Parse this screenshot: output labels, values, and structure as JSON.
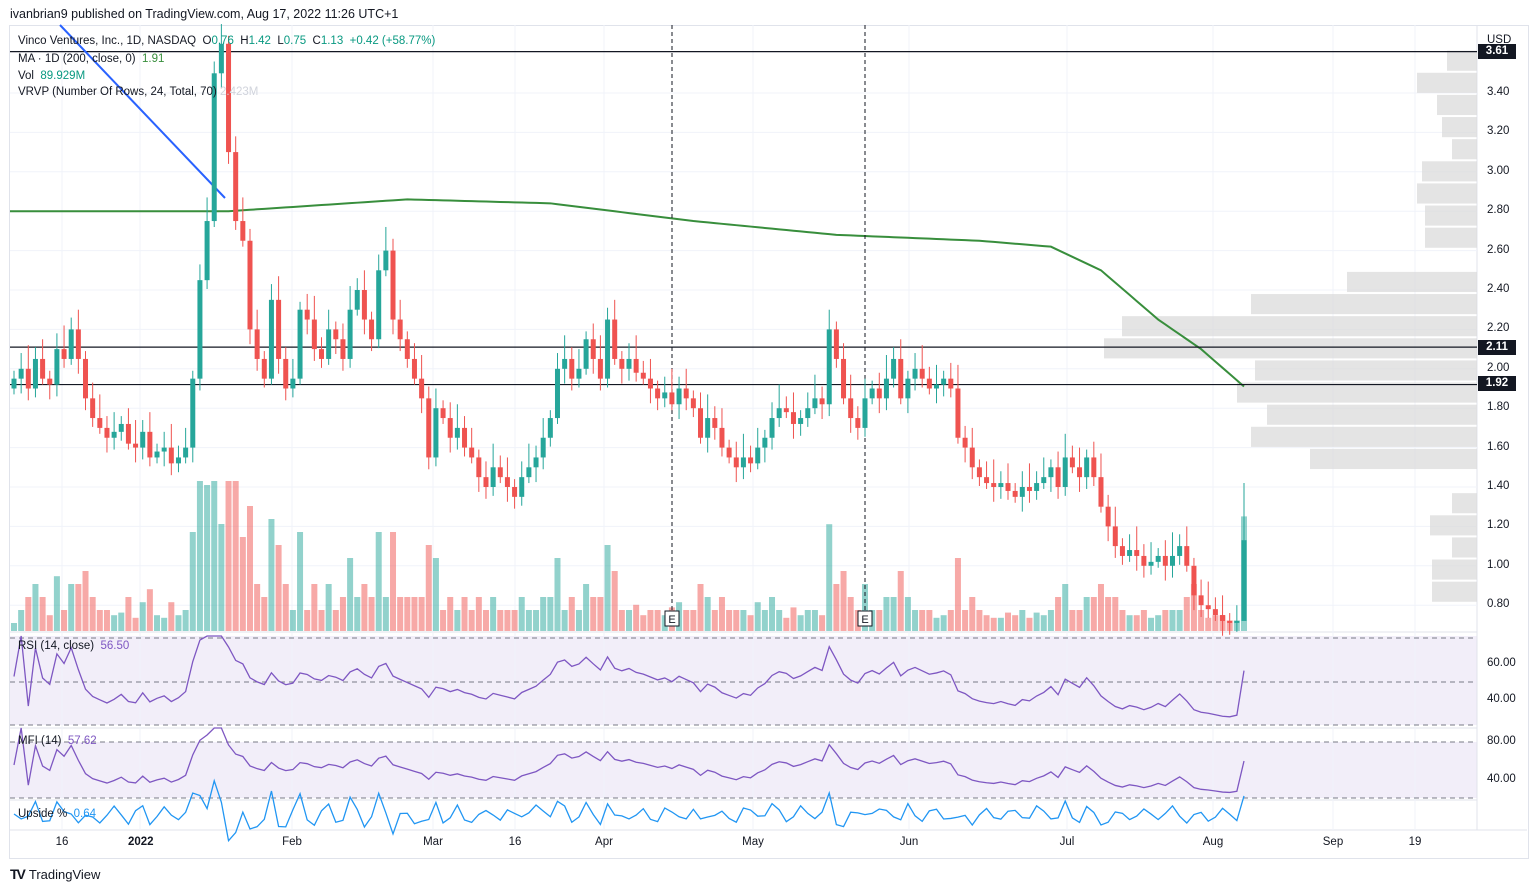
{
  "published": "ivanbrian9 published on TradingView.com, Aug 17, 2022 11:26 UTC+1",
  "legend": {
    "symbol": "Vinco Ventures, Inc., 1D, NASDAQ",
    "o_label": "O",
    "o": "0.76",
    "h_label": "H",
    "h": "1.42",
    "l_label": "L",
    "l": "0.75",
    "c_label": "C",
    "c": "1.13",
    "change": "+0.42 (+58.77%)",
    "ma": "MA · 1D (200, close, 0)",
    "ma_val": "1.91",
    "vol": "Vol",
    "vol_val": "89.929M",
    "vrvp": "VRVP (Number Of Rows, 24, Total, 70)",
    "vrvp_val": "2.423M",
    "rsi": "RSI (14, close)",
    "rsi_val": "56.50",
    "mfi": "MFI (14)",
    "mfi_val": "57.62",
    "upside": "Upside %",
    "upside_val": "0.64"
  },
  "currency": "USD",
  "price_ticks": [
    "3.40",
    "3.20",
    "3.00",
    "2.80",
    "2.60",
    "2.40",
    "2.20",
    "2.00",
    "1.80",
    "1.60",
    "1.40",
    "1.20",
    "1.00",
    "0.80"
  ],
  "price_tags": [
    "3.61",
    "2.11",
    "1.92"
  ],
  "rsi_ticks": [
    "60.00",
    "40.00"
  ],
  "mfi_ticks": [
    "80.00",
    "40.00"
  ],
  "time_ticks": [
    {
      "t": "16",
      "bold": false
    },
    {
      "t": "2022",
      "bold": true
    },
    {
      "t": "Feb",
      "bold": false
    },
    {
      "t": "Mar",
      "bold": false
    },
    {
      "t": "16",
      "bold": false
    },
    {
      "t": "Apr",
      "bold": false
    },
    {
      "t": "May",
      "bold": false
    },
    {
      "t": "Jun",
      "bold": false
    },
    {
      "t": "Jul",
      "bold": false
    },
    {
      "t": "Aug",
      "bold": false
    },
    {
      "t": "Sep",
      "bold": false
    },
    {
      "t": "19",
      "bold": false
    }
  ],
  "earnings_marker": "E",
  "brand": "TradingView",
  "colors": {
    "up": "#26a69a",
    "down": "#ef5350",
    "ma": "#388e3c",
    "rsi": "#7e57c2",
    "upside": "#2196f3",
    "trend": "#2962ff"
  },
  "chart_data": {
    "type": "candlestick",
    "closes": [
      1.95,
      2.0,
      1.9,
      2.05,
      1.95,
      1.92,
      2.1,
      2.05,
      2.2,
      2.05,
      1.85,
      1.75,
      1.7,
      1.65,
      1.68,
      1.72,
      1.62,
      1.6,
      1.68,
      1.55,
      1.58,
      1.6,
      1.52,
      1.55,
      1.6,
      1.95,
      2.45,
      2.75,
      3.5,
      3.65,
      3.1,
      2.75,
      2.65,
      2.2,
      2.05,
      1.95,
      2.35,
      2.05,
      1.9,
      1.95,
      2.3,
      2.25,
      2.1,
      2.05,
      2.2,
      2.15,
      2.05,
      2.3,
      2.4,
      2.25,
      2.15,
      2.5,
      2.6,
      2.25,
      2.15,
      2.05,
      1.95,
      1.85,
      1.55,
      1.8,
      1.75,
      1.65,
      1.7,
      1.6,
      1.55,
      1.45,
      1.4,
      1.5,
      1.45,
      1.4,
      1.35,
      1.45,
      1.5,
      1.55,
      1.65,
      1.75,
      2.0,
      2.05,
      1.95,
      2.0,
      2.15,
      2.05,
      1.95,
      2.25,
      2.05,
      2.0,
      2.05,
      1.98,
      1.95,
      1.9,
      1.85,
      1.88,
      1.82,
      1.9,
      1.85,
      1.8,
      1.65,
      1.75,
      1.7,
      1.6,
      1.55,
      1.5,
      1.55,
      1.52,
      1.6,
      1.65,
      1.75,
      1.8,
      1.78,
      1.72,
      1.75,
      1.8,
      1.85,
      1.82,
      2.2,
      2.05,
      1.85,
      1.75,
      1.7,
      1.85,
      1.9,
      1.85,
      1.95,
      2.05,
      1.85,
      1.95,
      2.0,
      1.95,
      1.9,
      1.92,
      1.95,
      1.9,
      1.65,
      1.6,
      1.5,
      1.45,
      1.42,
      1.4,
      1.42,
      1.38,
      1.35,
      1.4,
      1.38,
      1.42,
      1.45,
      1.5,
      1.4,
      1.55,
      1.5,
      1.45,
      1.55,
      1.45,
      1.3,
      1.2,
      1.1,
      1.05,
      1.08,
      1.05,
      1.0,
      1.02,
      1.05,
      1.0,
      1.05,
      1.1,
      1.0,
      0.85,
      0.8,
      0.78,
      0.75,
      0.72,
      0.71,
      0.72,
      1.13
    ],
    "ma200_keypoints": [
      [
        0,
        2.8
      ],
      [
        30,
        2.8
      ],
      [
        55,
        2.86
      ],
      [
        75,
        2.84
      ],
      [
        95,
        2.75
      ],
      [
        115,
        2.68
      ],
      [
        135,
        2.65
      ],
      [
        145,
        2.62
      ],
      [
        152,
        2.5
      ],
      [
        160,
        2.25
      ],
      [
        166,
        2.1
      ],
      [
        172,
        1.91
      ]
    ],
    "hlines": [
      3.61,
      2.11,
      1.92
    ],
    "earnings_bar_index": [
      92,
      119
    ],
    "vrvp_rows": [
      0,
      45,
      45,
      25,
      47,
      25,
      0,
      167,
      226,
      210,
      240,
      222,
      373,
      355,
      226,
      130,
      0,
      52,
      52,
      60,
      55,
      25,
      35,
      40,
      60,
      30
    ],
    "y_range": [
      0.7,
      3.62
    ]
  }
}
